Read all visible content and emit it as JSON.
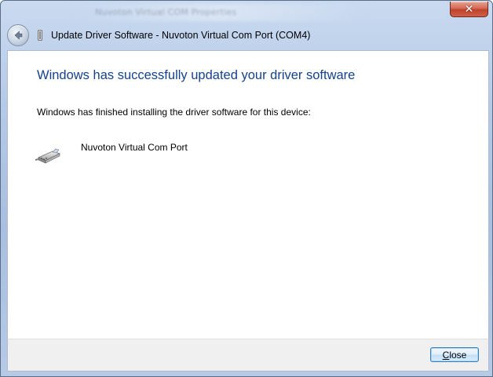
{
  "window": {
    "title_caption": "Update Driver Software - Nuvoton Virtual Com Port (COM4)",
    "background_title_blurred": "Nuvoton Virtual COM Properties",
    "close_glyph": "✕"
  },
  "content": {
    "heading": "Windows has successfully updated your driver software",
    "subtext": "Windows has finished installing the driver software for this device:",
    "device_name": "Nuvoton Virtual Com Port",
    "device_icon": "serial-port-icon"
  },
  "footer": {
    "close_label": "Close"
  },
  "colors": {
    "heading": "#15428b",
    "titlebar_top": "#c9daf0",
    "titlebar_bottom": "#b6cae6",
    "close_btn_red": "#c0422b",
    "footer_bg": "#f0f0f0"
  }
}
